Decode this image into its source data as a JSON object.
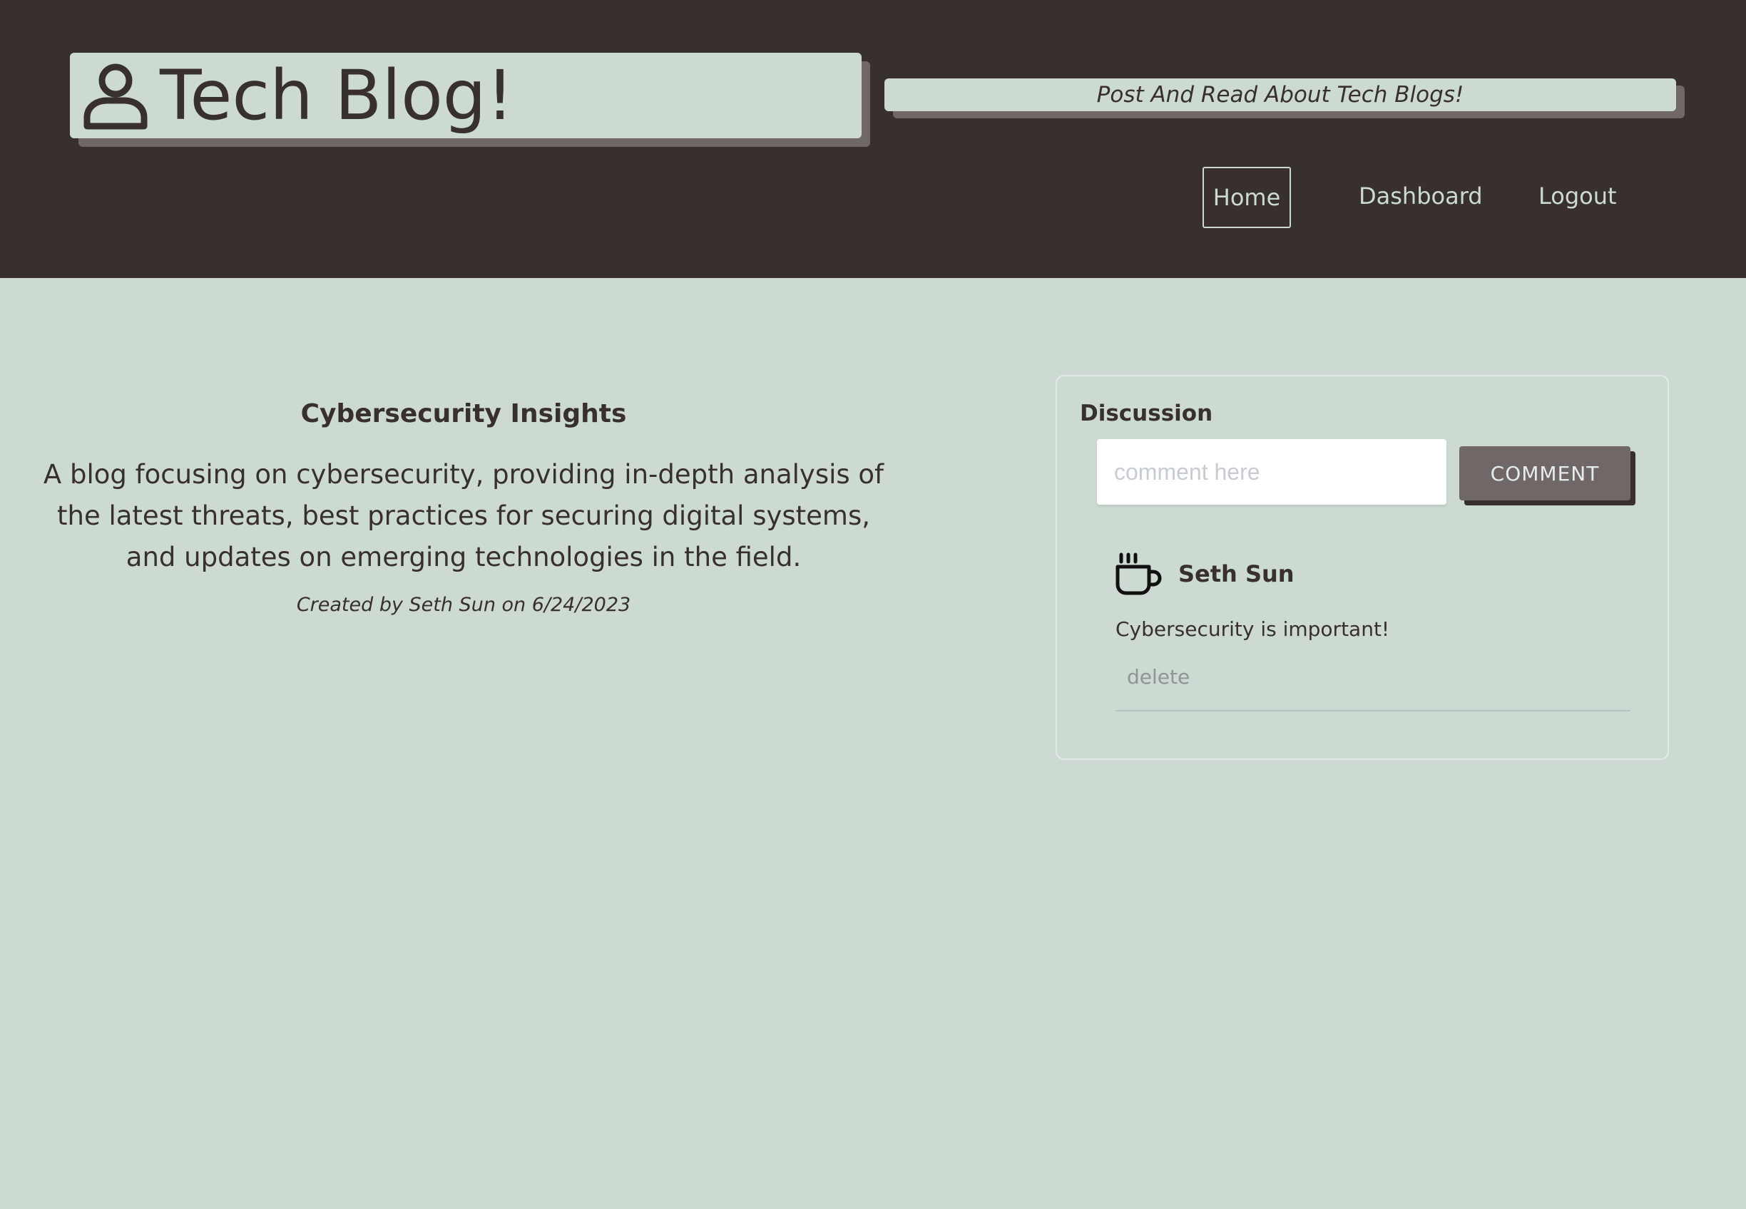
{
  "header": {
    "brand_title": "Tech Blog!",
    "brand_icon": "user-icon",
    "tagline": "Post And Read About Tech Blogs!",
    "nav": [
      {
        "label": "Home",
        "active": true
      },
      {
        "label": "Dashboard",
        "active": false
      },
      {
        "label": "Logout",
        "active": false
      }
    ]
  },
  "post": {
    "title": "Cybersecurity Insights",
    "body": "A blog focusing on cybersecurity, providing in-depth analysis of the latest threats, best practices for securing digital systems, and updates on emerging technologies in the field.",
    "meta": "Created by Seth Sun on 6/24/2023"
  },
  "discussion": {
    "title": "Discussion",
    "input_placeholder": "comment here",
    "input_value": "",
    "submit_label": "COMMENT",
    "comments": [
      {
        "icon": "coffee-cup-icon",
        "author": "Seth Sun",
        "text": "Cybersecurity is important!",
        "delete_label": "delete"
      }
    ]
  },
  "colors": {
    "dark": "#38302e",
    "background": "#ccdad1",
    "button": "#6f6866",
    "shadow": "#6f6866"
  }
}
